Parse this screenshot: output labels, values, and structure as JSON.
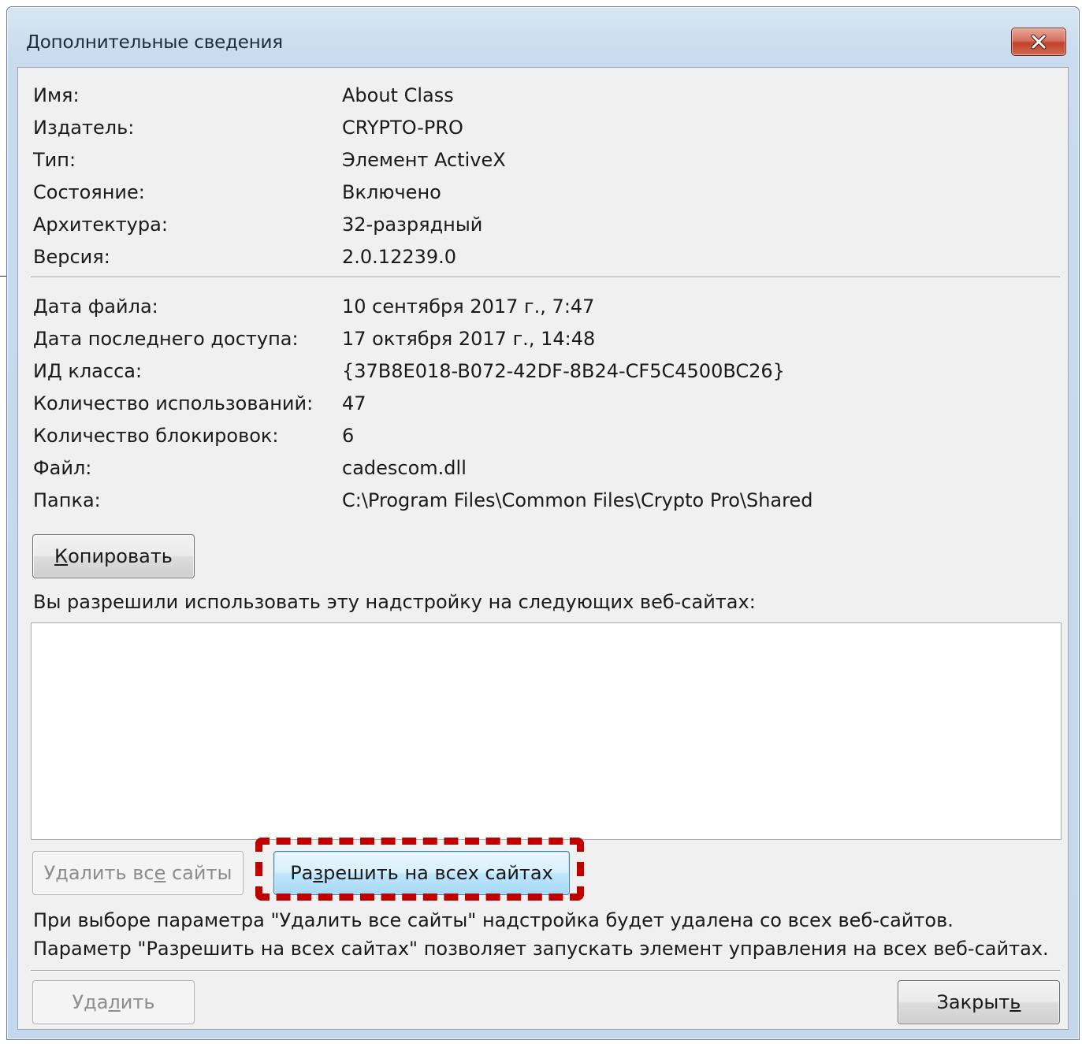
{
  "window": {
    "title": "Дополнительные сведения"
  },
  "properties": [
    {
      "label": "Имя:",
      "value": "About Class"
    },
    {
      "label": "Издатель:",
      "value": "CRYPTO-PRO"
    },
    {
      "label": "Тип:",
      "value": "Элемент ActiveX"
    },
    {
      "label": "Состояние:",
      "value": "Включено"
    },
    {
      "label": "Архитектура:",
      "value": "32-разрядный"
    },
    {
      "label": "Версия:",
      "value": "2.0.12239.0"
    }
  ],
  "file_info": [
    {
      "label": "Дата файла:",
      "value": "10 сентября 2017 г., 7:47"
    },
    {
      "label": "Дата последнего доступа:",
      "value": "17 октября 2017 г., 14:48"
    },
    {
      "label": "ИД класса:",
      "value": "{37B8E018-B072-42DF-8B24-CF5C4500BC26}"
    },
    {
      "label": "Количество использований:",
      "value": "47"
    },
    {
      "label": "Количество блокировок:",
      "value": "6"
    },
    {
      "label": "Файл:",
      "value": "cadescom.dll"
    },
    {
      "label": "Папка:",
      "value": "C:\\Program Files\\Common Files\\Crypto Pro\\Shared"
    }
  ],
  "buttons": {
    "copy": {
      "pre": "",
      "accel": "К",
      "post": "опировать"
    },
    "remove_all_sites": {
      "pre": "Удалить вс",
      "accel": "е",
      "post": " сайты"
    },
    "allow_all_sites": {
      "pre": "Ра",
      "accel": "з",
      "post": "решить на всех сайтах"
    },
    "delete": {
      "pre": "Уда",
      "accel": "л",
      "post": "ить"
    },
    "close": {
      "pre": "Закрыт",
      "accel": "ь",
      "post": ""
    }
  },
  "sites_label": "Вы разрешили использовать эту надстройку на следующих веб-сайтах:",
  "sites": [],
  "help_lines": [
    "При выборе параметра \"Удалить все сайты\" надстройка будет удалена со всех веб-сайтов.",
    "Параметр \"Разрешить на всех сайтах\" позволяет запускать элемент управления на всех веб-сайтах."
  ],
  "highlight_color": "#c00000"
}
